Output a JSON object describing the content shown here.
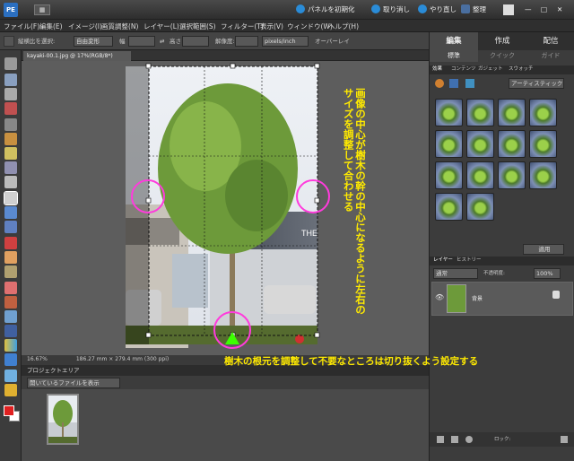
{
  "titlebar": {
    "view_label": "▦",
    "fix_panel": "パネルを初期化",
    "undo": "取り消し",
    "redo": "やり直し",
    "organize": "整理"
  },
  "menu": [
    "ファイル(F)",
    "編集(E)",
    "イメージ(I)",
    "画質調整(N)",
    "レイヤー(L)",
    "選択範囲(S)",
    "フィルター(T)",
    "表示(V)",
    "ウィンドウ(W)",
    "ヘルプ(H)"
  ],
  "options": {
    "aspect_label": "縦横比を選択:",
    "aspect_value": "自由変形",
    "width_label": "幅",
    "height_label": "高さ",
    "res_label": "解像度:",
    "res_unit": "pixels/inch",
    "overlay": "オーバーレイ"
  },
  "document": {
    "tab": "kayaki-00.1.jpg @ 17%(RGB/8*)",
    "zoom": "16.67%",
    "info": "186.27 mm × 279.4 mm (300 ppi)"
  },
  "project": {
    "title": "プロジェクトエリア",
    "filter": "開いているファイルを表示"
  },
  "right_panel": {
    "tabs": [
      "編集",
      "作成",
      "配信"
    ],
    "subtabs": [
      "標準",
      "クイック",
      "ガイド"
    ],
    "effects_tabs": [
      "効果",
      "コンテンツ",
      "ガジェット",
      "スウォッチ"
    ],
    "effects_select": "アーティスティック",
    "apply_label": "適用",
    "layers_tabs": [
      "レイヤー",
      "ヒストリー"
    ],
    "blend": "通常",
    "opacity_label": "不透明度:",
    "opacity_value": "100%",
    "lock_label": "ロック:",
    "layer_name": "背景"
  },
  "annotations": {
    "vertical": "画像の中心が樹木の幹の中心になるように左右のサイズを調整して合わせる",
    "bottom": "樹木の根元を調整して不要なところは切り抜くよう設定する"
  },
  "colors": {
    "highlight": "#ff3bdc",
    "marker": "#3cff00",
    "text": "#ffea00",
    "fg": "#e02020",
    "bg": "#ffffff"
  },
  "photo_labels": {
    "sign": "THE"
  }
}
